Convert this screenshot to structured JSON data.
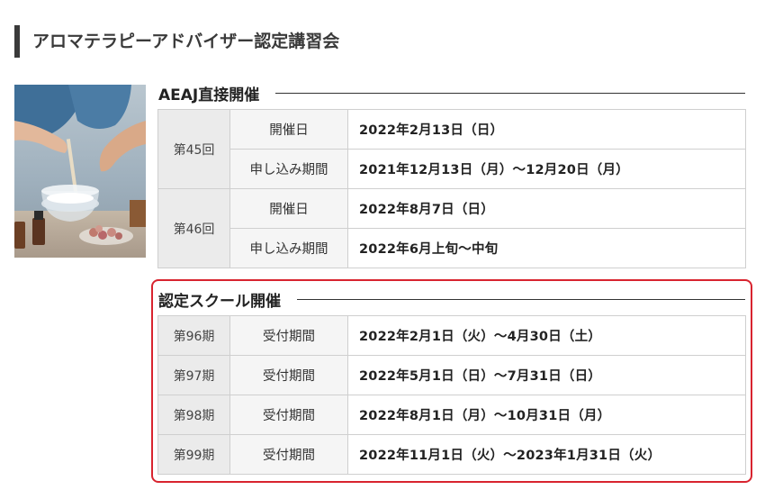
{
  "page": {
    "title": "アロマテラピーアドバイザー認定講習会"
  },
  "sections": [
    {
      "heading": "AEAJ直接開催",
      "sessions": [
        {
          "number": "第45回",
          "rows": [
            {
              "label": "開催日",
              "value": "2022年2月13日（日）"
            },
            {
              "label": "申し込み期間",
              "value": "2021年12月13日（月）〜12月20日（月）"
            }
          ]
        },
        {
          "number": "第46回",
          "rows": [
            {
              "label": "開催日",
              "value": "2022年8月7日（日）"
            },
            {
              "label": "申し込み期間",
              "value": "2022年6月上旬〜中旬"
            }
          ]
        }
      ]
    },
    {
      "heading": "認定スクール開催",
      "highlight_color": "#d8242f",
      "rows": [
        {
          "number": "第96期",
          "label": "受付期間",
          "value": "2022年2月1日（火）〜4月30日（土）"
        },
        {
          "number": "第97期",
          "label": "受付期間",
          "value": "2022年5月1日（日）〜7月31日（日）"
        },
        {
          "number": "第98期",
          "label": "受付期間",
          "value": "2022年8月1日（月）〜10月31日（月）"
        },
        {
          "number": "第99期",
          "label": "受付期間",
          "value": "2022年11月1日（火）〜2023年1月31日（火）"
        }
      ]
    }
  ]
}
